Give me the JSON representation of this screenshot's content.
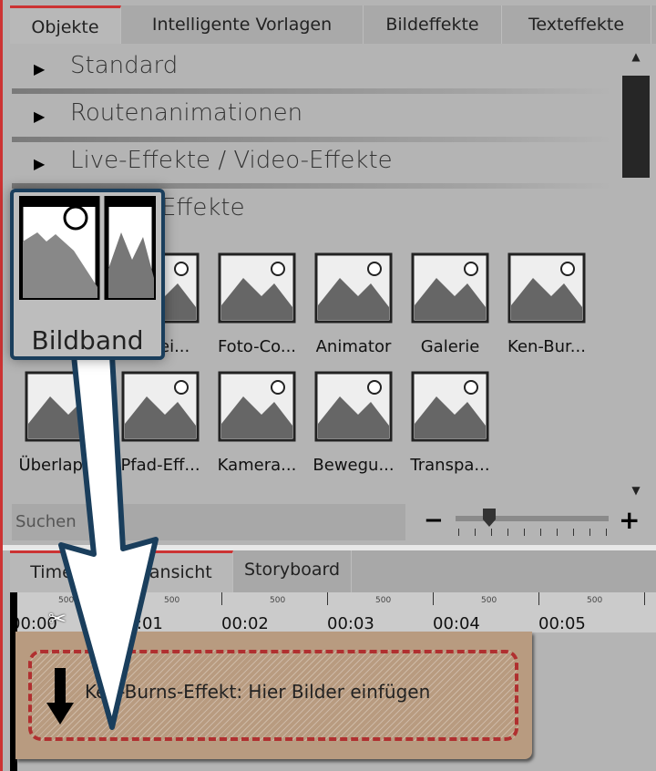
{
  "top_tabs": [
    {
      "label": "Objekte",
      "active": true
    },
    {
      "label": "Intelligente Vorlagen"
    },
    {
      "label": "Bildeffekte"
    },
    {
      "label": "Texteffekte"
    }
  ],
  "sections": [
    "Standard",
    "Routenanimationen",
    "Live-Effekte / Video-Effekte",
    "Effekte"
  ],
  "items_row1": [
    "Bildband",
    "...trei...",
    "Foto-Co...",
    "Animator",
    "Galerie",
    "Ken-Bur..."
  ],
  "items_row2": [
    "Überlapp...",
    "Pfad-Eff...",
    "Kamera...",
    "Bewegu...",
    "Transpa..."
  ],
  "search": {
    "placeholder": "Suchen"
  },
  "zoom": {
    "minus": "−",
    "plus": "+",
    "value": 0.2
  },
  "bottom_tabs": [
    {
      "label": "Timeline / Kuransicht",
      "active": true
    },
    {
      "label": "Storyboard"
    }
  ],
  "ruler": {
    "labels": [
      "00:00",
      "00:01",
      "00:02",
      "00:03",
      "00:04",
      "00:05"
    ],
    "minor": "500"
  },
  "clip": {
    "text": "Ken-Burns-Effekt: Hier Bilder einfügen"
  },
  "popup": {
    "label": "Bildband"
  },
  "colors": {
    "accent": "#c33333",
    "popup_border": "#1a3e5c",
    "clip": "#b89b80"
  }
}
